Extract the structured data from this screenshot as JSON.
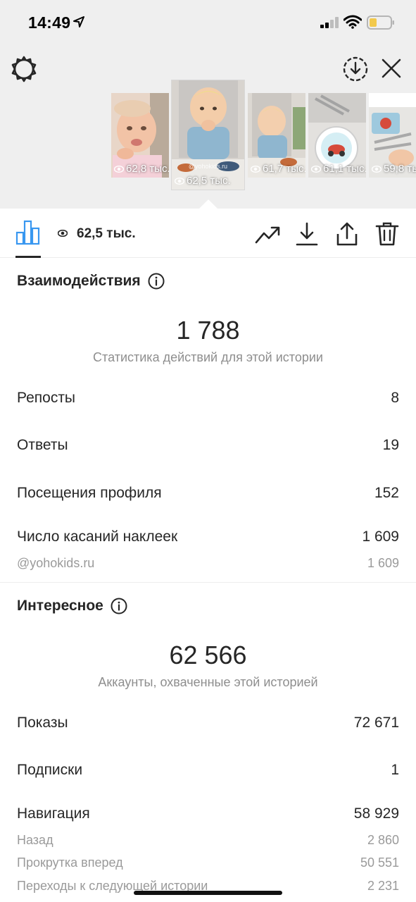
{
  "status_bar": {
    "time": "14:49",
    "icons": [
      "location-arrow-icon",
      "cellular-signal-icon",
      "wifi-icon",
      "battery-icon"
    ],
    "battery_color": "#f2c94c"
  },
  "header": {
    "icons": [
      "settings-icon",
      "download-circle-icon",
      "close-icon"
    ]
  },
  "thumbnails": [
    {
      "views": "62,8 тыс.",
      "handle": "",
      "selected": false
    },
    {
      "views": "62,5 тыс.",
      "handle": "@yohokids.ru",
      "selected": true
    },
    {
      "views": "61,7 тыс.",
      "handle": "",
      "selected": false
    },
    {
      "views": "61,1 тыс.",
      "handle": "",
      "selected": false
    },
    {
      "views": "59,8 тыс.",
      "handle": "",
      "selected": false
    }
  ],
  "toolbar": {
    "views": "62,5 тыс.",
    "icons": [
      "bar-chart-icon",
      "eye-icon",
      "trending-icon",
      "download-icon",
      "share-icon",
      "trash-icon"
    ]
  },
  "interactions": {
    "title": "Взаимодействия",
    "total": "1 788",
    "caption": "Статистика действий для этой истории",
    "rows": [
      {
        "label": "Репосты",
        "value": "8"
      },
      {
        "label": "Ответы",
        "value": "19"
      },
      {
        "label": "Посещения профиля",
        "value": "152"
      },
      {
        "label": "Число касаний наклеек",
        "value": "1 609"
      }
    ],
    "sub_rows": [
      {
        "label": "@yohokids.ru",
        "value": "1 609"
      }
    ]
  },
  "discovery": {
    "title": "Интересное",
    "total": "62 566",
    "caption": "Аккаунты, охваченные этой историей",
    "rows": [
      {
        "label": "Показы",
        "value": "72 671"
      },
      {
        "label": "Подписки",
        "value": "1"
      },
      {
        "label": "Навигация",
        "value": "58 929"
      }
    ],
    "sub_rows": [
      {
        "label": "Назад",
        "value": "2 860"
      },
      {
        "label": "Прокрутка вперед",
        "value": "50 551"
      },
      {
        "label": "Переходы к следующей истории",
        "value": "2 231"
      }
    ]
  },
  "colors": {
    "accent_blue": "#3897f0",
    "text_primary": "#262626",
    "text_secondary": "#8e8e8e",
    "header_bg": "#efefef"
  }
}
